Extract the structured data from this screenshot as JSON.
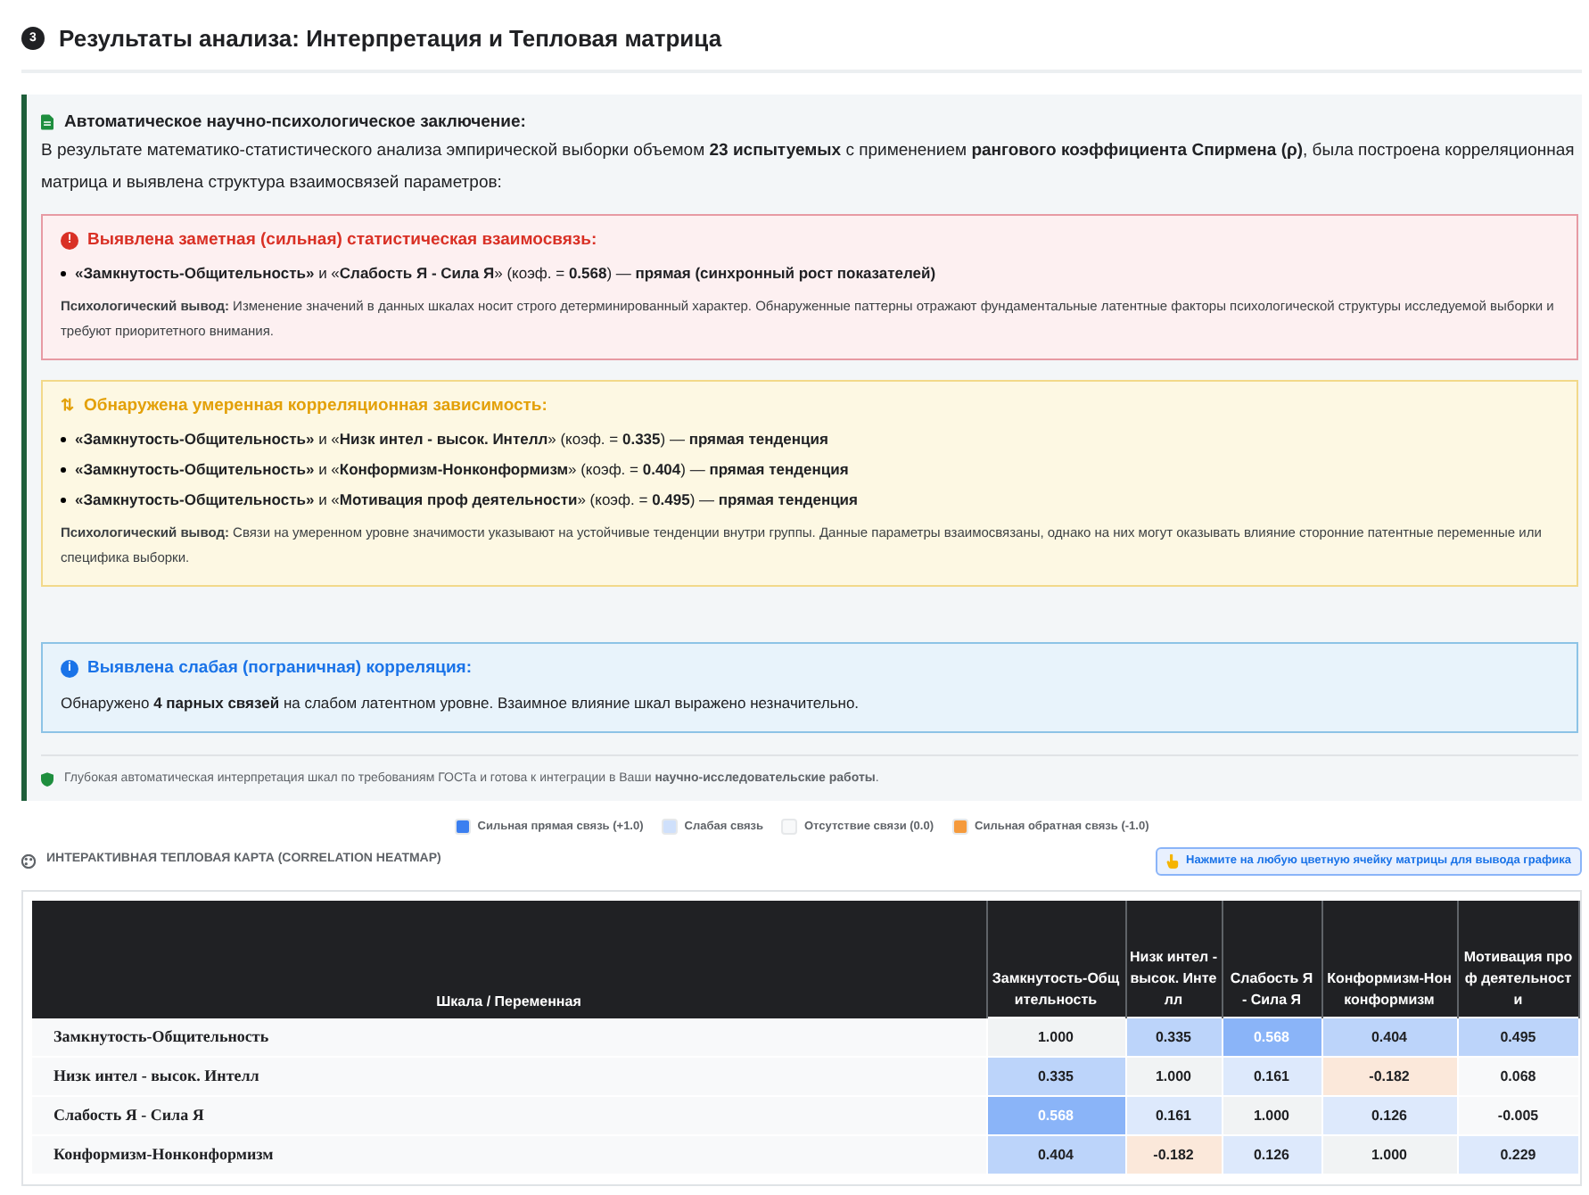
{
  "section": {
    "number": "3",
    "title": "Результаты анализа: Интерпретация и Тепловая матрица"
  },
  "conclusion": {
    "title": "Автоматическое научно-психологическое заключение:",
    "intro": "В результате математико-статистического анализа эмпирической выборки объемом **23 испытуемых** с применением **рангового коэффициента Спирмена (ρ)**, была построена корреляционная матрица и выявлена структура взаимосвязей параметров:",
    "alerts": [
      {
        "kind": "strong",
        "icon": "!",
        "title": "Выявлена заметная (сильная) статистическая взаимосвязь:",
        "items": [
          "**«Замкнутость-Общительность»** и «**Слабость Я - Сила Я**» (коэф. = **0.568**) — **прямая (синхронный рост показателей)**"
        ],
        "note": "**Психологический вывод:** Изменение значений в данных шкалах носит строго детерминированный характер. Обнаруженные паттерны отражают фундаментальные латентные факторы психологической структуры исследуемой выборки и требуют приоритетного внимания."
      },
      {
        "kind": "moderate",
        "icon": "⇅",
        "title": "Обнаружена умеренная корреляционная зависимость:",
        "items": [
          "**«Замкнутость-Общительность»** и «**Низк интел - высок. Интелл**» (коэф. = **0.335**) — **прямая тенденция**",
          "**«Замкнутость-Общительность»** и «**Конформизм-Нонконформизм**» (коэф. = **0.404**) — **прямая тенденция**",
          "**«Замкнутость-Общительность»** и «**Мотивация проф деятельности**» (коэф. = **0.495**) — **прямая тенденция**"
        ],
        "note": "**Психологический вывод:** Связи на умеренном уровне значимости указывают на устойчивые тенденции внутри группы. Данные параметры взаимосвязаны, однако на них могут оказывать влияние сторонние патентные переменные или специфика выборки."
      },
      {
        "kind": "weak",
        "icon": "i",
        "title": "Выявлена слабая (пограничная) корреляция:",
        "note": "Обнаружено **4 парных связей** на слабом латентном уровне. Взаимное влияние шкал выражено незначительно."
      }
    ],
    "footer": "Глубокая автоматическая интерпретация шкал по требованиям ГОСТа и готова к интеграции в Ваши **научно-исследовательские работы**."
  },
  "legend": [
    {
      "label": "Сильная прямая связь (+1.0)",
      "color": "#3b7ff0"
    },
    {
      "label": "Слабая связь",
      "color": "#cfe0fb"
    },
    {
      "label": "Отсутствие связи (0.0)",
      "color": "#f8f9fa"
    },
    {
      "label": "Сильная обратная связь (-1.0)",
      "color": "#f59a3c"
    }
  ],
  "heatmap": {
    "title": "ИНТЕРАКТИВНАЯ ТЕПЛОВАЯ КАРТА (CORRELATION HEATMAP)",
    "hint_button": "Нажмите на любую цветную ячейку матрицы для вывода графика",
    "columns": [
      "Шкала / Переменная",
      "Замкнутость-Общительность",
      "Низк интел - высок. Интелл",
      "Слабость Я - Сила Я",
      "Конформизм-Нонконформизм",
      "Мотивация проф деятельности"
    ],
    "rows": [
      [
        "Замкнутость-Общительность",
        "1.000",
        "0.335",
        "0.568",
        "0.404",
        "0.495"
      ],
      [
        "Низк интел - высок. Интелл",
        "0.335",
        "1.000",
        "0.161",
        "-0.182",
        "0.068"
      ],
      [
        "Слабость Я - Сила Я",
        "0.568",
        "0.161",
        "1.000",
        "0.126",
        "-0.005"
      ],
      [
        "Конформизм-Нонконформизм",
        "0.404",
        "-0.182",
        "0.126",
        "1.000",
        "0.229"
      ]
    ]
  }
}
